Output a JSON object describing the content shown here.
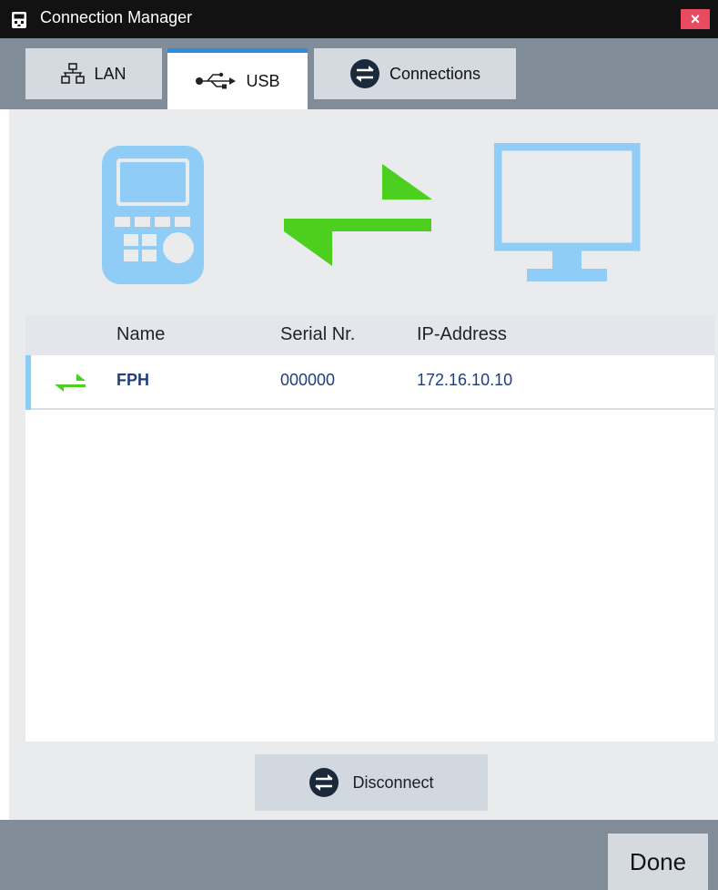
{
  "window": {
    "title": "Connection Manager",
    "close_label": "×"
  },
  "tabs": [
    {
      "label": "LAN",
      "icon": "network-icon",
      "active": false
    },
    {
      "label": "USB",
      "icon": "usb-icon",
      "active": true
    },
    {
      "label": "Connections",
      "icon": "swap-circle-icon",
      "active": false
    }
  ],
  "table": {
    "headers": {
      "name": "Name",
      "serial": "Serial Nr.",
      "ip": "IP-Address"
    },
    "rows": [
      {
        "name": "FPH",
        "serial": "000000",
        "ip": "172.16.10.10"
      }
    ]
  },
  "actions": {
    "disconnect_label": "Disconnect",
    "done_label": "Done"
  },
  "colors": {
    "accent": "#2a8de0",
    "connected": "#4ccf1f",
    "device": "#8fcdf6",
    "close": "#e84a5f"
  }
}
